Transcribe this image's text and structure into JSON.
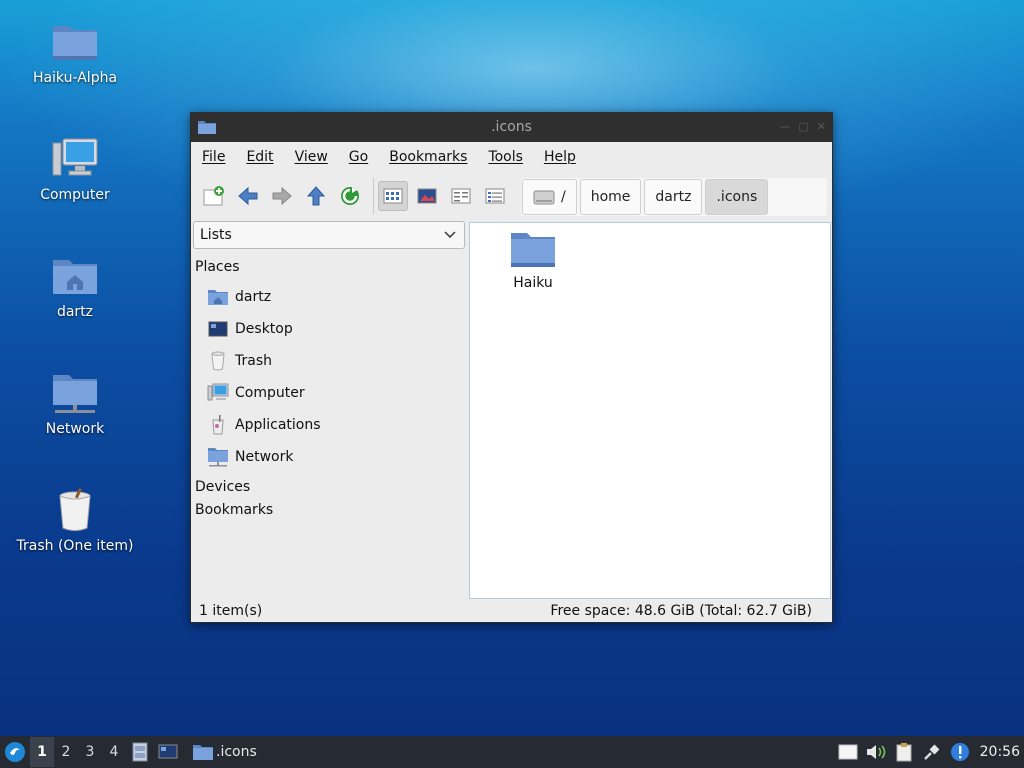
{
  "desktop": {
    "icons": [
      {
        "label": "Haiku-Alpha",
        "icon": "folder-icon"
      },
      {
        "label": "Computer",
        "icon": "computer-icon"
      },
      {
        "label": "dartz",
        "icon": "home-folder-icon"
      },
      {
        "label": "Network",
        "icon": "network-folder-icon"
      },
      {
        "label": "Trash (One item)",
        "icon": "trash-full-icon"
      }
    ]
  },
  "window": {
    "title": ".icons",
    "menu": [
      "File",
      "Edit",
      "View",
      "Go",
      "Bookmarks",
      "Tools",
      "Help"
    ],
    "toolbar": {
      "buttons": [
        "new-tab-icon",
        "back-icon",
        "forward-icon",
        "up-icon",
        "reload-icon",
        "icon-view-icon",
        "thumbnail-view-icon",
        "compact-view-icon",
        "detailed-view-icon"
      ]
    },
    "path": [
      "/",
      "home",
      "dartz",
      ".icons"
    ],
    "side": {
      "selector": "Lists",
      "places_header": "Places",
      "places": [
        {
          "label": "dartz",
          "icon": "home-folder-icon"
        },
        {
          "label": "Desktop",
          "icon": "desktop-icon"
        },
        {
          "label": "Trash",
          "icon": "trash-icon"
        },
        {
          "label": "Computer",
          "icon": "computer-icon"
        },
        {
          "label": "Applications",
          "icon": "applications-icon"
        },
        {
          "label": "Network",
          "icon": "network-folder-icon"
        }
      ],
      "devices_header": "Devices",
      "bookmarks_header": "Bookmarks"
    },
    "files": [
      {
        "name": "Haiku",
        "icon": "folder-icon"
      }
    ],
    "status": {
      "count": "1 item(s)",
      "free": "Free space: 48.6 GiB (Total: 62.7 GiB)"
    }
  },
  "taskbar": {
    "workspaces": [
      "1",
      "2",
      "3",
      "4"
    ],
    "active_workspace": "1",
    "task_label": ".icons",
    "clock": "20:56"
  },
  "colors": {
    "taskbar": "#262b33",
    "titlebar": "#2f2f2f",
    "folder": "#6a93d0"
  }
}
